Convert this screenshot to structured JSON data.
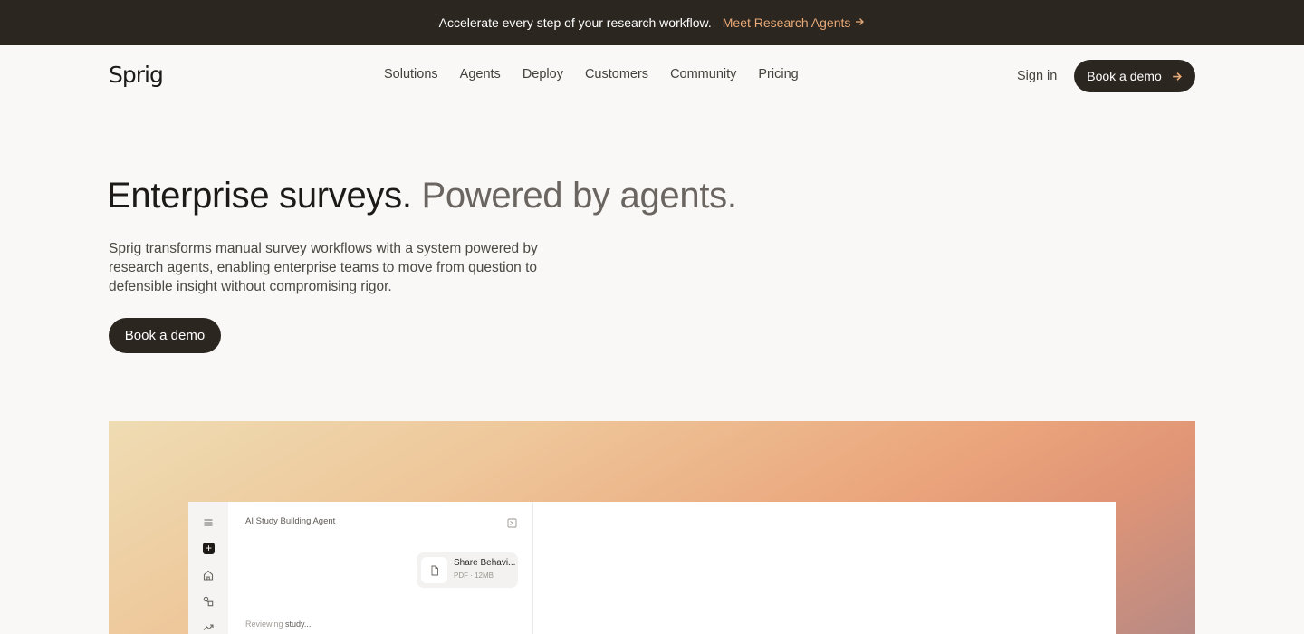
{
  "announcement": {
    "text": "Accelerate every step of your research workflow.",
    "link_label": "Meet Research Agents",
    "link_color": "#e9a977"
  },
  "nav": {
    "logo": "Sprig",
    "menu": [
      "Solutions",
      "Agents",
      "Deploy",
      "Customers",
      "Community",
      "Pricing"
    ],
    "sign_in": "Sign in",
    "cta_label": "Book a demo",
    "cta_icon": "arrow-right-icon"
  },
  "hero": {
    "title_main": "Enterprise surveys.",
    "title_muted": "Powered by agents.",
    "subtitle": "Sprig transforms manual survey workflows with a system powered by research agents, enabling enterprise teams to move from question to defensible insight without compromising rigor.",
    "cta_label": "Book a demo"
  },
  "app_preview": {
    "rail_icons": [
      "menu-icon",
      "plus-icon",
      "home-icon",
      "shapes-icon",
      "trending-icon"
    ],
    "panel_title": "AI Study Building Agent",
    "panel_action_icon": "sidebar-toggle-icon",
    "file": {
      "name": "Share Behavi...",
      "meta": "PDF · 12MB",
      "icon": "file-icon"
    },
    "status_prefix": "Reviewing ",
    "status_emphasis": "study..."
  },
  "colors": {
    "dark": "#2b2620",
    "background": "#f9f8f6",
    "accent": "#e9a977"
  }
}
